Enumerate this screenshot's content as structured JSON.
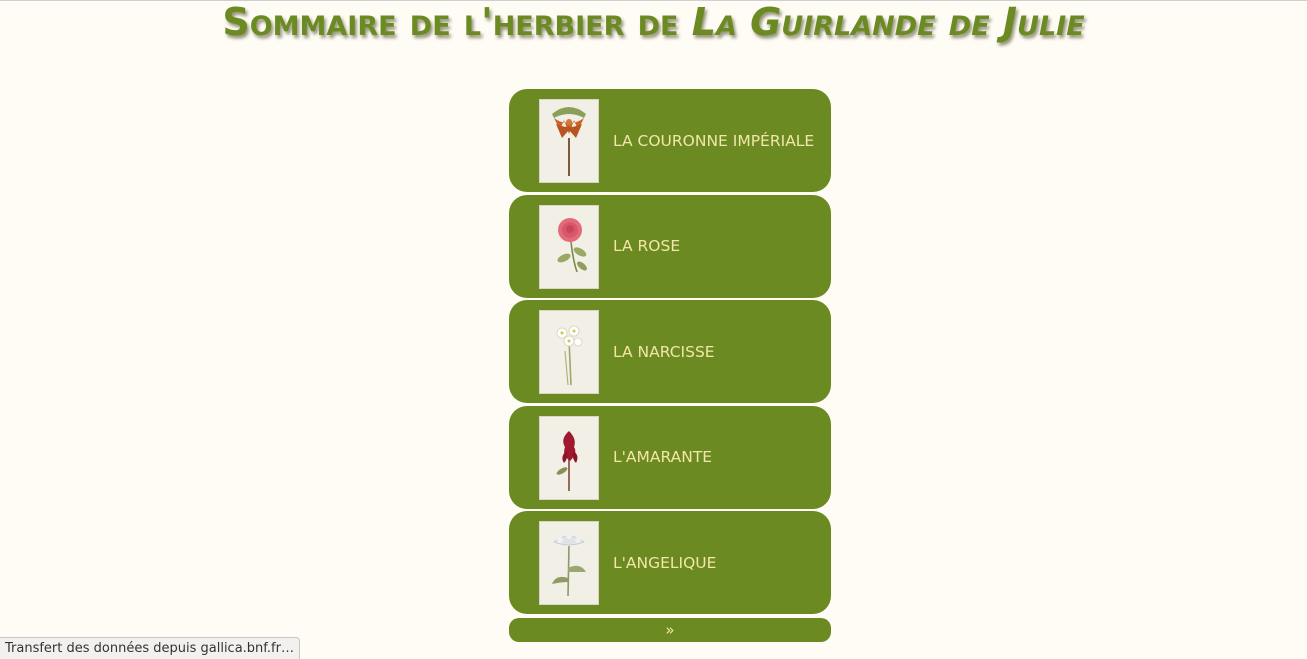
{
  "page": {
    "title_part1": "Sommaire de l'herbier de",
    "title_part2": "La Guirlande de Julie"
  },
  "plants": [
    {
      "label": "LA COURONNE IMPÉRIALE",
      "icon": "crown-imperial-plate"
    },
    {
      "label": "LA ROSE",
      "icon": "rose-plate"
    },
    {
      "label": "LA NARCISSE",
      "icon": "narcissus-plate"
    },
    {
      "label": "L'AMARANTE",
      "icon": "amaranth-plate"
    },
    {
      "label": "L'ANGELIQUE",
      "icon": "angelica-plate"
    }
  ],
  "pagination": {
    "next_label": "»"
  },
  "status": {
    "text": "Transfert des données depuis gallica.bnf.fr…"
  },
  "colors": {
    "accent": "#6b8a22",
    "card_text": "#f3e6a6",
    "background": "#fffcf6"
  }
}
